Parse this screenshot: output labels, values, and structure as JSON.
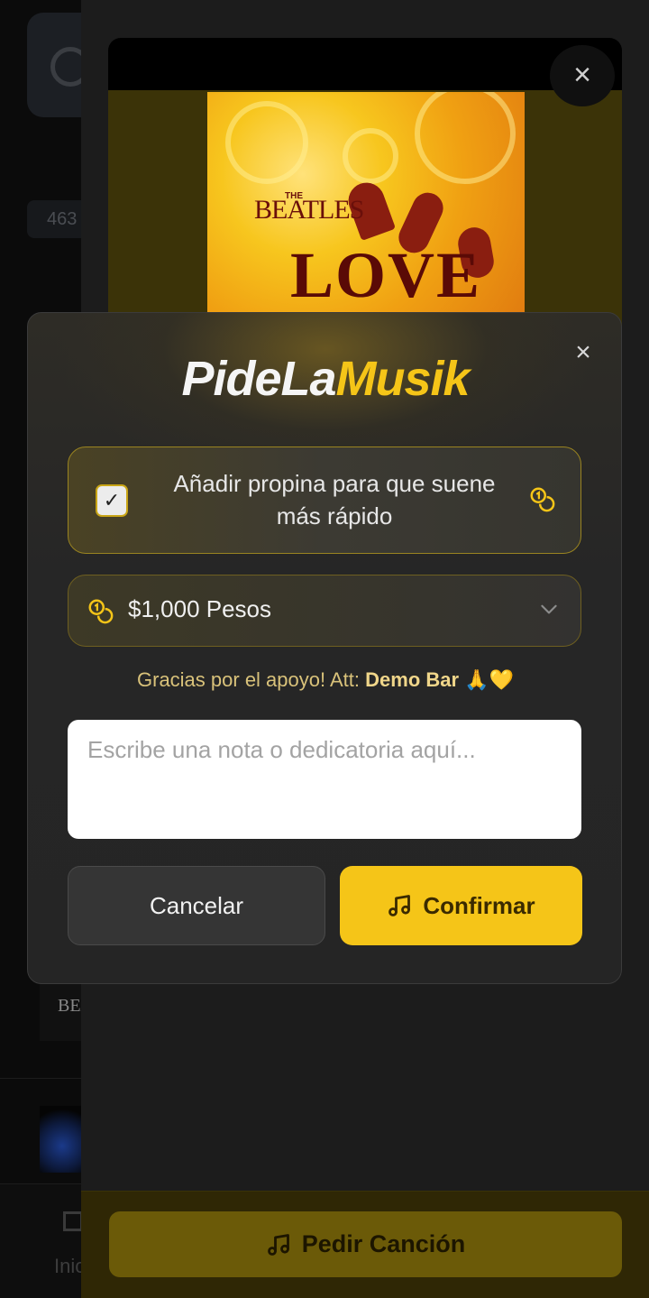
{
  "background": {
    "count_badge": "463",
    "nav_home_label": "Inicio",
    "thumb_text": "BEAT"
  },
  "album": {
    "line1": "THE",
    "line2": "BEATLES",
    "title": "LOVE"
  },
  "sheet": {
    "request_button_label": "Pedir Canción"
  },
  "modal": {
    "brand_part1": "PideLa",
    "brand_part2": "Musik",
    "tip_option": {
      "label": "Añadir propina para que suene más rápido",
      "checked": true
    },
    "amount": {
      "selected": "$1,000 Pesos"
    },
    "thanks_prefix": "Gracias por el apoyo! Att:",
    "thanks_name": "Demo Bar",
    "thanks_emoji": "🙏💛",
    "note": {
      "value": "",
      "placeholder": "Escribe una nota o dedicatoria aquí..."
    },
    "cancel_label": "Cancelar",
    "confirm_label": "Confirmar"
  },
  "colors": {
    "accent": "#f5c518",
    "surface": "#262626",
    "background": "#0a0a0a"
  }
}
